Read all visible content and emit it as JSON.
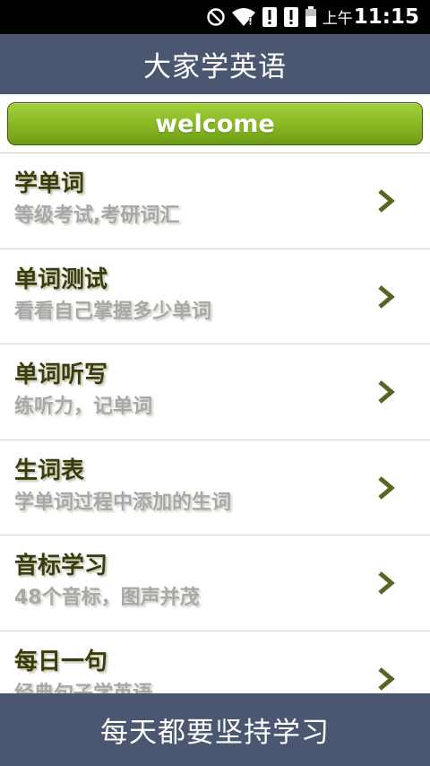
{
  "status_bar": {
    "icons": [
      "do-not-disturb-icon",
      "wifi-icon",
      "alert-icon",
      "alert-icon",
      "battery-icon"
    ],
    "ampm": "上午",
    "time": "11:15"
  },
  "header": {
    "title": "大家学英语"
  },
  "welcome": {
    "label": "welcome"
  },
  "menu": {
    "items": [
      {
        "title": "学单词",
        "subtitle": "等级考试,考研词汇"
      },
      {
        "title": "单词测试",
        "subtitle": "看看自己掌握多少单词"
      },
      {
        "title": "单词听写",
        "subtitle": "练听力，记单词"
      },
      {
        "title": "生词表",
        "subtitle": "学单词过程中添加的生词"
      },
      {
        "title": "音标学习",
        "subtitle": "48个音标，图声并茂"
      },
      {
        "title": "每日一句",
        "subtitle": "经典句子学英语"
      }
    ],
    "arrow_icon": "chevron-right-icon"
  },
  "footer": {
    "text": "每天都要坚持学习"
  },
  "colors": {
    "bar_bg": "#4b5770",
    "welcome_green": "#8bbc26",
    "item_title": "#3a3d0b",
    "item_subtitle": "#a8a8a8",
    "arrow": "#5c6423"
  }
}
